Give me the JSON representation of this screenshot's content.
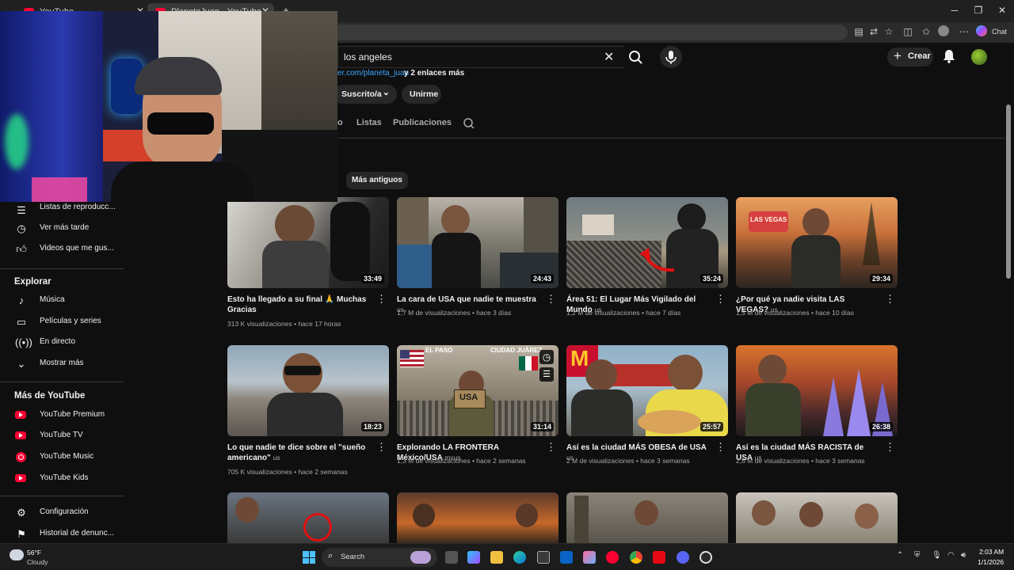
{
  "browser": {
    "tabs": [
      {
        "title": "YouTube"
      },
      {
        "title": "PlanetaJuan - YouTube"
      }
    ],
    "toolbar_label": "Chat"
  },
  "header": {
    "search_value": "los angeles",
    "create_label": "Crear"
  },
  "channel": {
    "link_text": "er.com/planeta_juan",
    "link_more": "y 2 enlaces más",
    "subscribed_label": "Suscrito/a",
    "join_label": "Unirme",
    "tabs": [
      "o",
      "Listas",
      "Publicaciones"
    ],
    "sort_label": "Más antiguos"
  },
  "sidebar": {
    "you_items": [
      {
        "label": "Listas de reproducc...",
        "icon": "playlist-icon"
      },
      {
        "label": "Ver más tarde",
        "icon": "clock-icon"
      },
      {
        "label": "Videos que me gus...",
        "icon": "thumbs-up-icon"
      }
    ],
    "explore_heading": "Explorar",
    "explore_items": [
      {
        "label": "Música",
        "icon": "music-note-icon"
      },
      {
        "label": "Películas y series",
        "icon": "film-icon"
      },
      {
        "label": "En directo",
        "icon": "live-icon"
      },
      {
        "label": "Mostrar más",
        "icon": "chevron-down-icon"
      }
    ],
    "more_heading": "Más de YouTube",
    "more_items": [
      {
        "label": "YouTube Premium",
        "icon": "youtube-logo-icon"
      },
      {
        "label": "YouTube TV",
        "icon": "youtube-logo-icon"
      },
      {
        "label": "YouTube Music",
        "icon": "youtube-music-icon"
      },
      {
        "label": "YouTube Kids",
        "icon": "youtube-logo-icon"
      }
    ],
    "bottom_items": [
      {
        "label": "Configuración",
        "icon": "gear-icon"
      },
      {
        "label": "Historial de denunc...",
        "icon": "flag-icon"
      }
    ]
  },
  "videos": [
    {
      "title": "Esto ha llegado a su final 🙏 Muchas Gracias",
      "duration": "33:49",
      "meta": "313 K visualizaciones • hace 17 horas"
    },
    {
      "title": "La cara de USA que nadie te muestra",
      "tag": "us",
      "duration": "24:43",
      "meta": "1,7 M de visualizaciones • hace 3 días"
    },
    {
      "title": "Área 51: El Lugar Más Vigilado del Mundo",
      "tag": "us",
      "duration": "35:24",
      "meta": "1,2 M de visualizaciones • hace 7 días"
    },
    {
      "title": "¿Por qué ya nadie visita LAS VEGAS?",
      "tag": "us",
      "duration": "29:34",
      "meta": "1,5 M de visualizaciones • hace 10 días"
    },
    {
      "title": "Lo que nadie te dice sobre el \"sueño americano\"",
      "tag": "us",
      "duration": "18:23",
      "meta": "705 K visualizaciones • hace 2 semanas"
    },
    {
      "title": "Explorando LA FRONTERA México/USA",
      "tag": "mxus",
      "duration": "31:14",
      "meta": "1,3 M de visualizaciones • hace 2 semanas"
    },
    {
      "title": "Así es la ciudad MÁS OBESA de USA",
      "tag": "us",
      "duration": "25:57",
      "meta": "2 M de visualizaciones • hace 3 semanas"
    },
    {
      "title": "Así es la ciudad MÁS RACISTA de USA",
      "tag": "us",
      "duration": "26:38",
      "meta": "2,6 M de visualizaciones • hace 3 semanas"
    }
  ],
  "thumb_text": {
    "vegas": "LAS VEGAS",
    "paso": "EL PASO",
    "juarez": "CIUDAD JUÁREZ",
    "usa": "USA"
  },
  "taskbar": {
    "weather_temp": "56°F",
    "weather_desc": "Cloudy",
    "search_label": "Search",
    "time": "2:03 AM",
    "date": "1/1/2026"
  },
  "colors": {
    "background": "#0f0f0f",
    "accent_red": "#ff0033",
    "link_blue": "#3ea6ff"
  }
}
